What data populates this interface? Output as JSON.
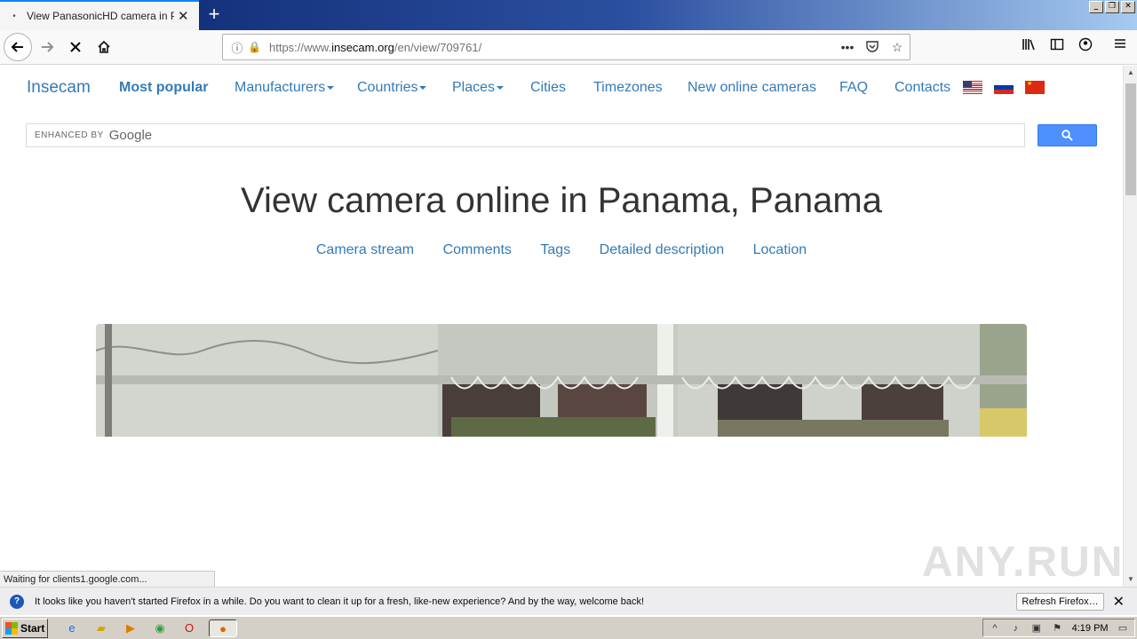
{
  "browser": {
    "tab_title": "View PanasonicHD camera in Panama",
    "new_tab": "+",
    "window_controls": [
      "_",
      "❐",
      "✕"
    ],
    "url_prefix": "https://www.",
    "url_domain": "insecam.org",
    "url_path": "/en/view/709761/",
    "page_actions": "•••"
  },
  "site": {
    "brand": "Insecam",
    "nav": {
      "popular": "Most popular",
      "manufacturers": "Manufacturers",
      "countries": "Countries",
      "places": "Places",
      "cities": "Cities",
      "timezones": "Timezones",
      "new_cameras": "New online cameras",
      "faq": "FAQ",
      "contacts": "Contacts"
    },
    "flags": [
      "us-flag",
      "ru-flag",
      "cn-flag"
    ],
    "search": {
      "enhanced_by": "ENHANCED BY",
      "google": "Google",
      "value": ""
    },
    "heading": "View camera online in Panama, Panama",
    "sections": {
      "stream": "Camera stream",
      "comments": "Comments",
      "tags": "Tags",
      "description": "Detailed description",
      "location": "Location"
    }
  },
  "status": {
    "loading": "Waiting for clients1.google.com..."
  },
  "watermark": "ANY.RUN",
  "notification": {
    "message": "It looks like you haven't started Firefox in a while. Do you want to clean it up for a fresh, like-new experience? And by the way, welcome back!",
    "button": "Refresh Firefox…"
  },
  "taskbar": {
    "start": "Start",
    "clock": "4:19 PM"
  },
  "colors": {
    "link": "#337ab7",
    "google_button": "#4d90fe",
    "heading": "#333333"
  }
}
